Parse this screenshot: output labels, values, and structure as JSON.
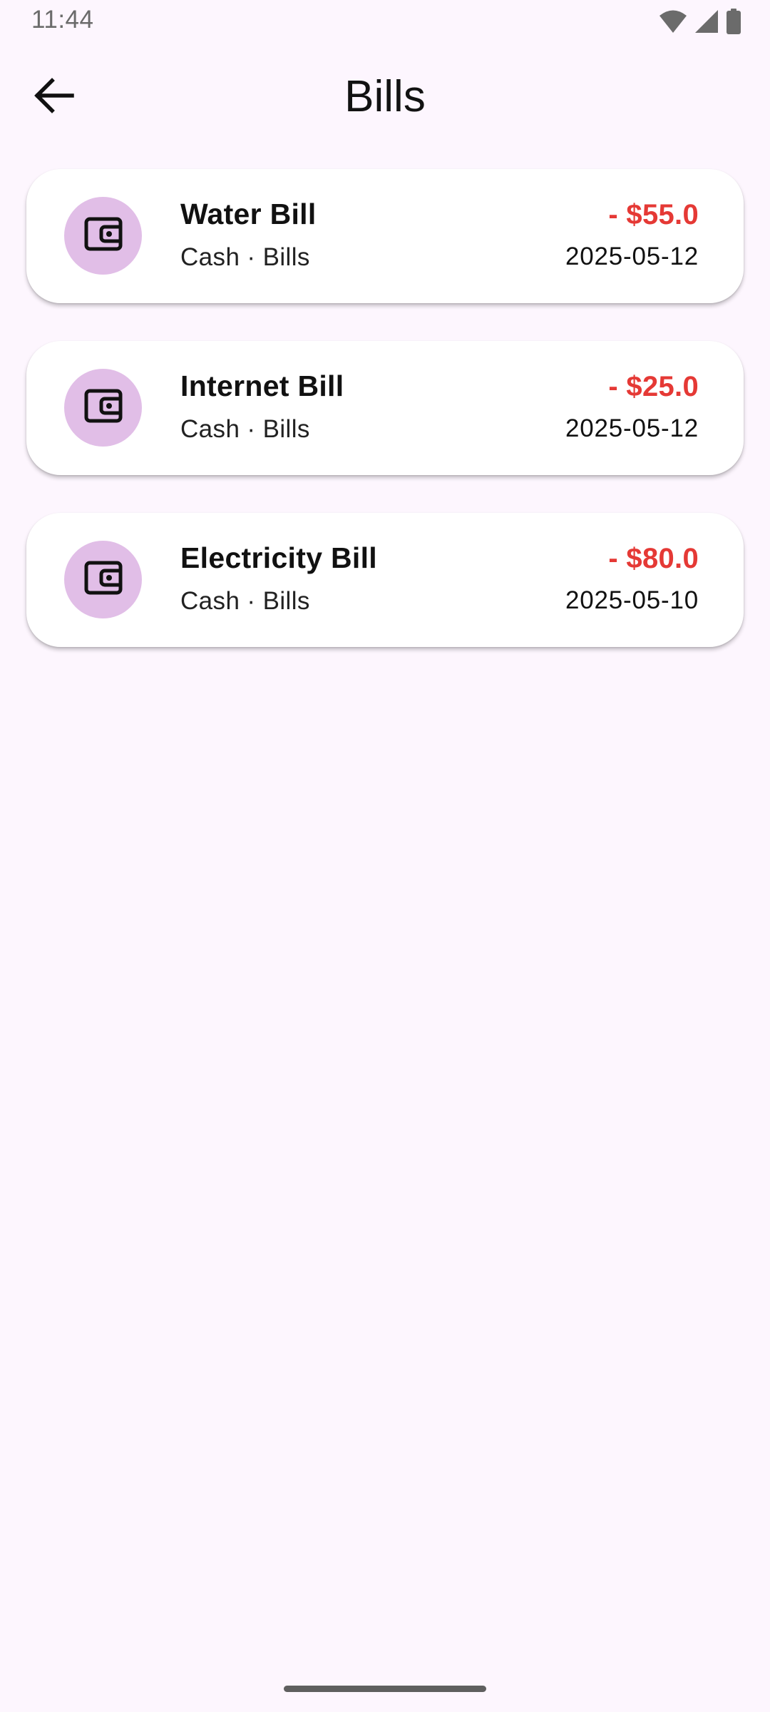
{
  "status_bar": {
    "time": "11:44",
    "icons": [
      "wifi-icon",
      "cellular-signal-icon",
      "battery-icon"
    ]
  },
  "app_bar": {
    "title": "Bills",
    "back_icon": "arrow-back-icon"
  },
  "colors": {
    "background": "#FDF6FE",
    "card": "#FFFFFF",
    "avatar_bg": "#E1BEE7",
    "expense": "#E53935"
  },
  "bills": [
    {
      "title": "Water Bill",
      "subtitle": "Cash · Bills",
      "amount": "- $55.0",
      "date": "2025-05-12",
      "icon": "wallet-icon"
    },
    {
      "title": "Internet Bill",
      "subtitle": "Cash · Bills",
      "amount": "- $25.0",
      "date": "2025-05-12",
      "icon": "wallet-icon"
    },
    {
      "title": "Electricity Bill",
      "subtitle": "Cash · Bills",
      "amount": "- $80.0",
      "date": "2025-05-10",
      "icon": "wallet-icon"
    }
  ]
}
